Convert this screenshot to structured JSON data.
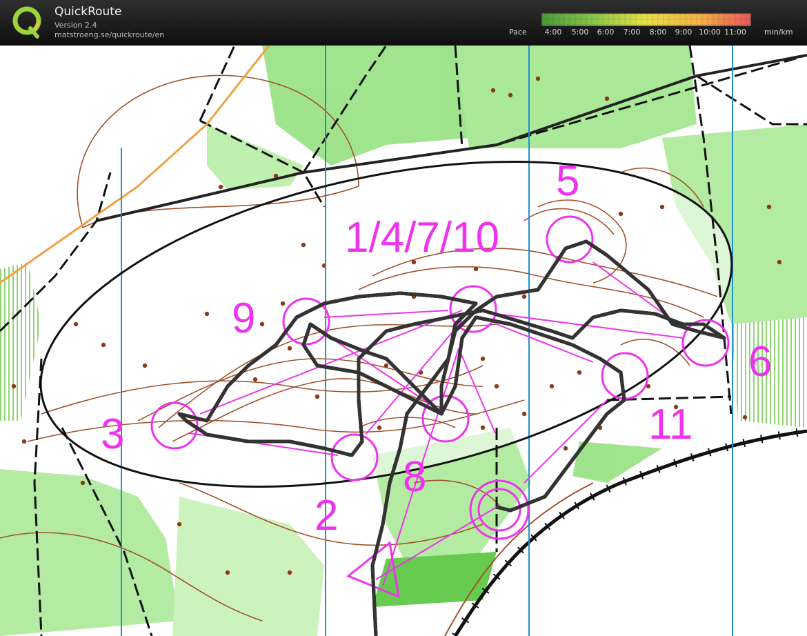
{
  "app": {
    "title": "QuickRoute",
    "version": "Version 2.4",
    "url": "matstroeng.se/quickroute/en"
  },
  "legend": {
    "label": "Pace",
    "unit": "min/km",
    "ticks": [
      "4:00",
      "5:00",
      "6:00",
      "7:00",
      "8:00",
      "9:00",
      "10:00",
      "11:00"
    ],
    "gradient_colors": [
      "#4a9a3a",
      "#7cc24a",
      "#c8dc4a",
      "#f0e04a",
      "#f0b048",
      "#ea6a5a"
    ]
  },
  "map": {
    "controls": [
      "1/4/7/10",
      "2",
      "3",
      "5",
      "6",
      "8",
      "9",
      "11"
    ],
    "course_color": "#ee33ee",
    "route_color": "#6e8a2a"
  }
}
